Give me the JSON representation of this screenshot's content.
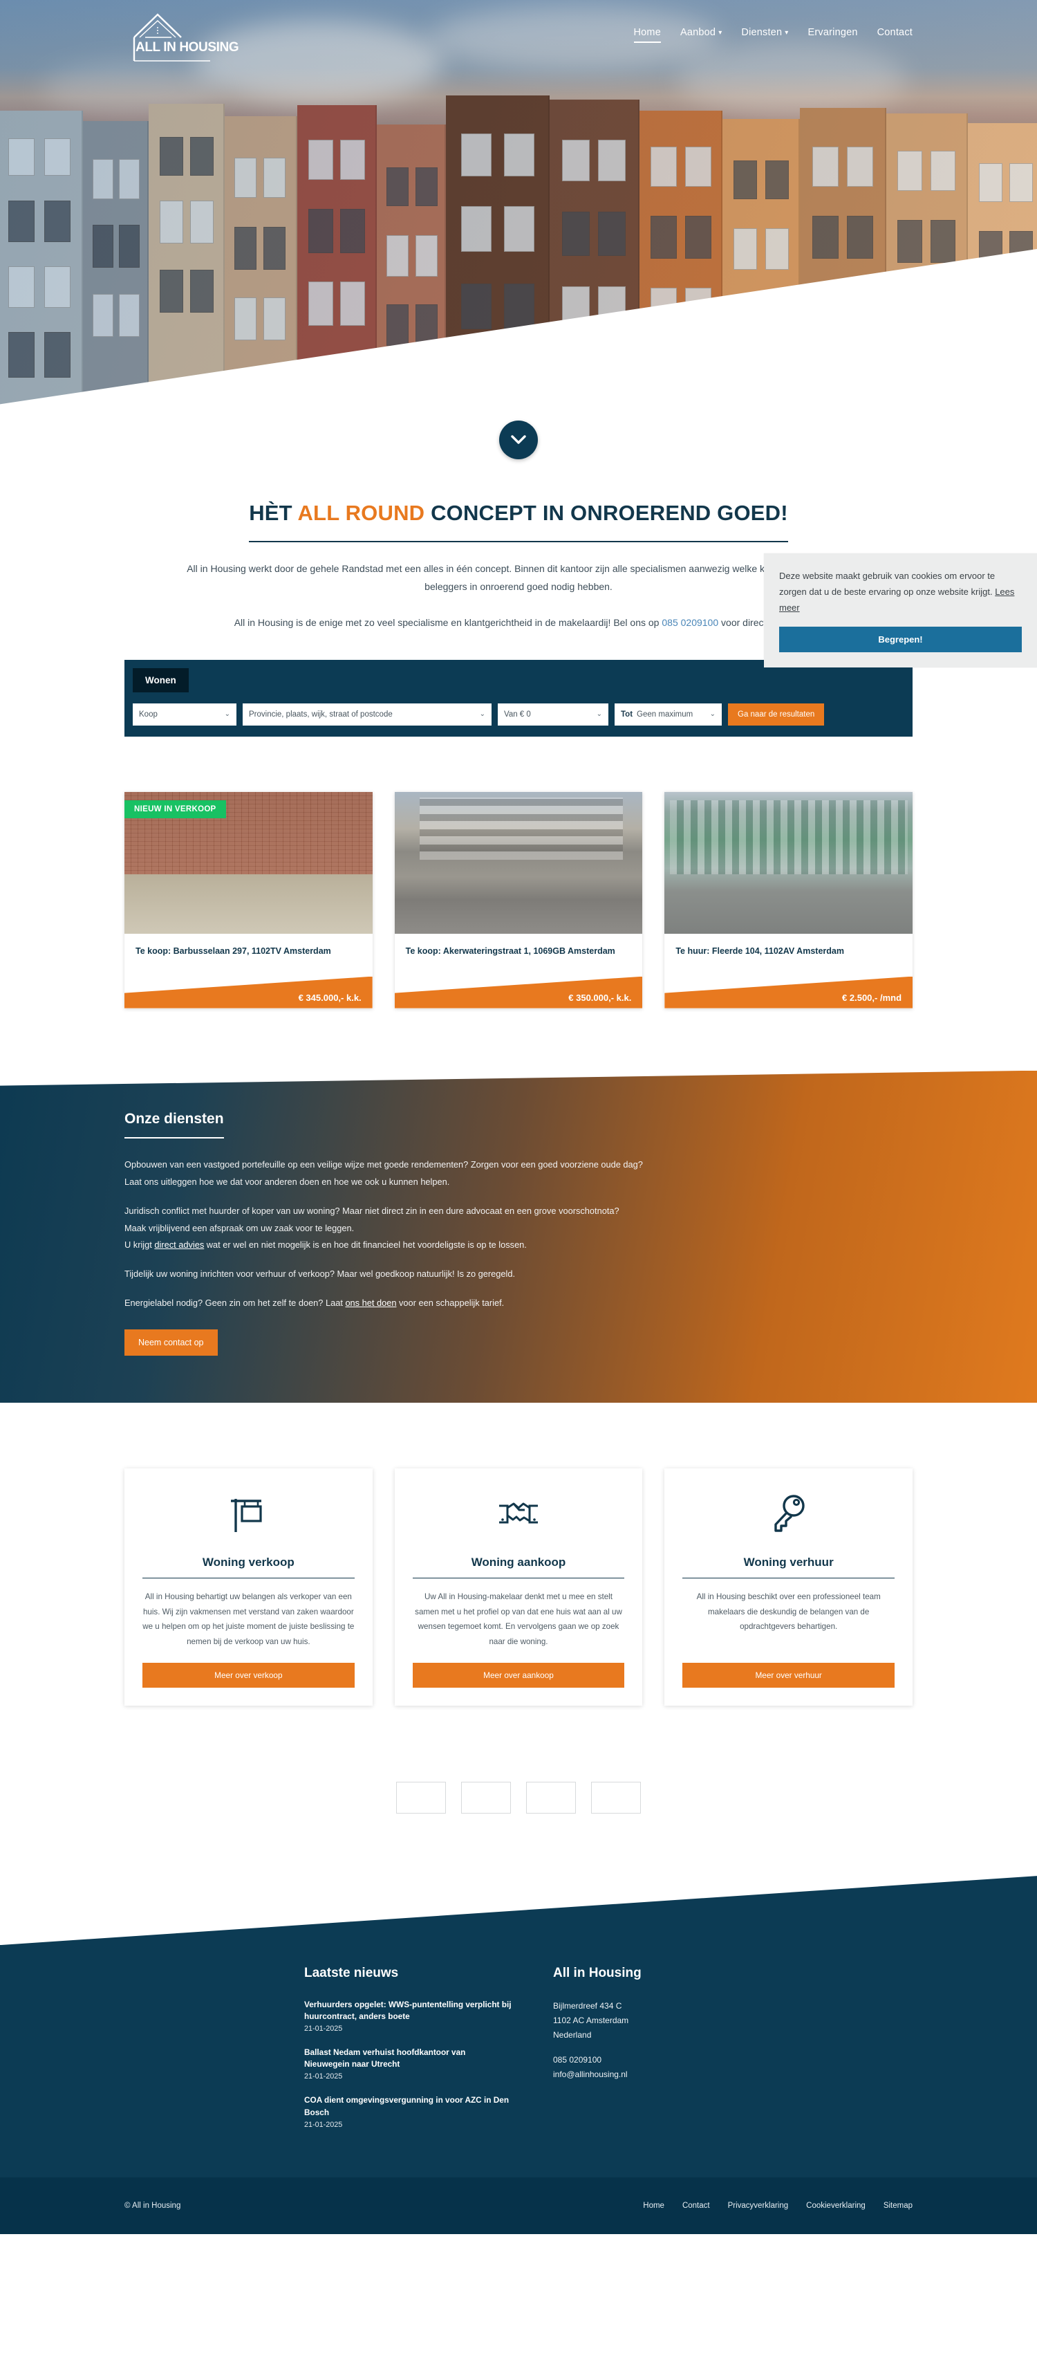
{
  "brand": {
    "logo_text": "ALL IN HOUSING",
    "logo_icon": "house-outline-icon"
  },
  "nav": {
    "items": [
      {
        "label": "Home",
        "active": true,
        "caret": false
      },
      {
        "label": "Aanbod",
        "active": false,
        "caret": true
      },
      {
        "label": "Diensten",
        "active": false,
        "caret": true
      },
      {
        "label": "Ervaringen",
        "active": false,
        "caret": false
      },
      {
        "label": "Contact",
        "active": false,
        "caret": false
      }
    ]
  },
  "hero": {
    "scroll_icon": "chevron-down-icon"
  },
  "intro": {
    "heading_pre": "HÈT ",
    "heading_highlight": "ALL ROUND",
    "heading_post": " CONCEPT IN ONROEREND GOED!",
    "paragraph1": "All in Housing werkt door de gehele Randstad met een alles in één concept. Binnen dit kantoor zijn alle specialismen aanwezig welke kopers, verkopers en beleggers in onroerend goed nodig hebben.",
    "paragraph2_pre": "All in Housing is de enige met zo veel specialisme en klantgerichtheid in de makelaardij! Bel ons op ",
    "paragraph2_phone": "085 0209100",
    "paragraph2_post": " voor direct contact!"
  },
  "cookie": {
    "text": "Deze website maakt gebruik van cookies om ervoor te zorgen dat u de beste ervaring op onze website krijgt.",
    "link": "Lees meer",
    "button": "Begrepen!",
    "button_color": "#1b6f9c"
  },
  "search": {
    "tab": "Wonen",
    "type_value": "Koop",
    "location_placeholder": "Provincie, plaats, wijk, straat of postcode",
    "from_value": "Van € 0",
    "to_prefix": "Tot",
    "to_value": "Geen maximum",
    "submit": "Ga naar de resultaten",
    "chevron_icon": "chevron-down-icon"
  },
  "listings": [
    {
      "badge": "NIEUW IN VERKOOP",
      "title": "Te koop: Barbusselaan 297, 1102TV Amsterdam",
      "price": "€ 345.000,- k.k."
    },
    {
      "badge": "",
      "title": "Te koop: Akerwateringstraat 1, 1069GB Amsterdam",
      "price": "€ 350.000,- k.k."
    },
    {
      "badge": "",
      "title": "Te huur: Fleerde 104, 1102AV Amsterdam",
      "price": "€ 2.500,- /mnd"
    }
  ],
  "diensten": {
    "heading": "Onze diensten",
    "p1": "Opbouwen van een vastgoed portefeuille op een veilige wijze met goede rendementen? Zorgen voor een goed voorziene oude dag?",
    "p2": "Laat ons uitleggen hoe we dat voor anderen doen en hoe we ook u kunnen helpen.",
    "p3": "Juridisch conflict met huurder of koper van uw woning? Maar niet direct zin in een dure advocaat en een grove voorschotnota?",
    "p4": "Maak vrijblijvend een afspraak om uw zaak voor te leggen.",
    "p5_pre": "U krijgt ",
    "p5_link": "direct advies",
    "p5_post": " wat er wel en niet mogelijk is en hoe dit financieel het voordeligste is op te lossen.",
    "p6": "Tijdelijk uw woning inrichten voor verhuur of verkoop? Maar wel goedkoop natuurlijk! Is zo geregeld.",
    "p7_pre": "Energielabel nodig? Geen zin om het zelf te doen? Laat ",
    "p7_link": "ons het doen",
    "p7_post": " voor een schappelijk tarief.",
    "button": "Neem contact op"
  },
  "services": [
    {
      "icon": "for-sale-sign-icon",
      "title": "Woning verkoop",
      "text": "All in Housing behartigt uw belangen als verkoper van een huis. Wij zijn vakmensen met verstand van zaken waardoor we u helpen om op het juiste moment de juiste beslissing te nemen bij de verkoop van uw huis.",
      "button": "Meer over verkoop"
    },
    {
      "icon": "handshake-icon",
      "title": "Woning aankoop",
      "text": "Uw All in Housing-makelaar denkt met u mee en stelt samen met u het profiel op van dat ene huis wat aan al uw wensen tegemoet komt. En vervolgens gaan we op zoek naar die woning.",
      "button": "Meer over aankoop"
    },
    {
      "icon": "key-icon",
      "title": "Woning verhuur",
      "text": "All in Housing beschikt over een professioneel team makelaars die deskundig de belangen van de opdrachtgevers behartigen.",
      "button": "Meer over verhuur"
    }
  ],
  "partners": [
    {
      "name": "partner-logo-1"
    },
    {
      "name": "partner-logo-2"
    },
    {
      "name": "partner-logo-3"
    },
    {
      "name": "partner-logo-4"
    }
  ],
  "footer": {
    "news_heading": "Laatste nieuws",
    "news": [
      {
        "title": "Verhuurders opgelet: WWS-puntentelling verplicht bij huurcontract, anders boete",
        "date": "21-01-2025"
      },
      {
        "title": "Ballast Nedam verhuist hoofdkantoor van Nieuwegein naar Utrecht",
        "date": "21-01-2025"
      },
      {
        "title": "COA dient omgevingsvergunning in voor AZC in Den Bosch",
        "date": "21-01-2025"
      }
    ],
    "company_heading": "All in Housing",
    "address_line1": "Bijlmerdreef 434 C",
    "address_line2": "1102 AC Amsterdam",
    "address_line3": "Nederland",
    "phone": "085 0209100",
    "email": "info@allinhousing.nl",
    "copyright": "© All in Housing",
    "links": [
      {
        "label": "Home"
      },
      {
        "label": "Contact"
      },
      {
        "label": "Privacyverklaring"
      },
      {
        "label": "Cookieverklaring"
      },
      {
        "label": "Sitemap"
      }
    ]
  },
  "colors": {
    "navy": "#0c3b54",
    "orange": "#e8791f",
    "green": "#18c163",
    "cookie_blue": "#1b6f9c"
  }
}
